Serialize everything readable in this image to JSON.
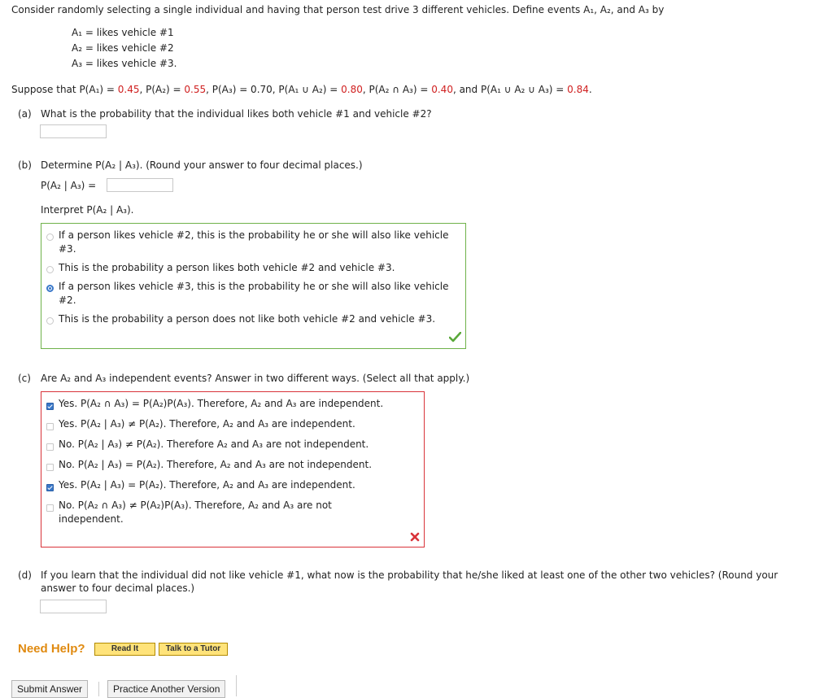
{
  "intro": "Consider randomly selecting a single individual and having that person test drive 3 different vehicles. Define events A₁, A₂, and A₃ by",
  "events": [
    "A₁ = likes vehicle #1",
    "A₂ = likes vehicle #2",
    "A₃ = likes vehicle #3."
  ],
  "suppose": {
    "prefix": "Suppose that ",
    "p1_label": "P(A₁) = ",
    "p1_value": "0.45",
    "p2_label": ", P(A₂) = ",
    "p2_value": "0.55",
    "p3_text": ", P(A₃) = 0.70, P(A₁ ∪ A₂) = ",
    "p12_value": "0.80",
    "p23_label": ", P(A₂ ∩ A₃) = ",
    "p23_value": "0.40",
    "p123_label": ", and P(A₁ ∪ A₂ ∪ A₃) = ",
    "p123_value": "0.84",
    "suffix": "."
  },
  "part_a": {
    "label": "(a)",
    "question": "What is the probability that the individual likes both vehicle #1 and vehicle #2?",
    "answer": ""
  },
  "part_b": {
    "label": "(b)",
    "question": "Determine P(A₂ | A₃). (Round your answer to four decimal places.)",
    "input_label": "P(A₂ | A₃) =",
    "answer": "",
    "interpret": "Interpret P(A₂ | A₃).",
    "options": [
      {
        "line1": "If a person likes vehicle #2, this is the probability he or she will also like vehicle",
        "line2": "#3."
      },
      {
        "line1": "This is the probability a person likes both vehicle #2 and vehicle #3.",
        "line2": ""
      },
      {
        "line1": "If a person likes vehicle #3, this is the probability he or she will also like vehicle",
        "line2": "#2."
      },
      {
        "line1": "This is the probability a person does not like both vehicle #2 and vehicle #3.",
        "line2": ""
      }
    ],
    "selected_index": 2,
    "result_icon": "check-icon",
    "result_color": "#5aa83a"
  },
  "part_c": {
    "label": "(c)",
    "question": "Are A₂ and A₃ independent events? Answer in two different ways. (Select all that apply.)",
    "options": [
      {
        "line1": "Yes. P(A₂ ∩ A₃) = P(A₂)P(A₃). Therefore, A₂ and A₃ are independent.",
        "line2": "",
        "checked": true
      },
      {
        "line1": "Yes. P(A₂ | A₃) ≠ P(A₂). Therefore, A₂ and A₃ are independent.",
        "line2": "",
        "checked": false
      },
      {
        "line1": "No. P(A₂ | A₃) ≠ P(A₂). Therefore A₂ and A₃ are not independent.",
        "line2": "",
        "checked": false
      },
      {
        "line1": "No. P(A₂ | A₃) = P(A₂). Therefore, A₂ and A₃ are not independent.",
        "line2": "",
        "checked": false
      },
      {
        "line1": "Yes. P(A₂ | A₃) = P(A₂). Therefore, A₂ and A₃ are independent.",
        "line2": "",
        "checked": true
      },
      {
        "line1": "No. P(A₂ ∩ A₃) ≠ P(A₂)P(A₃). Therefore, A₂ and A₃ are not",
        "line2": "independent.",
        "checked": false
      }
    ],
    "result_icon": "x-icon",
    "result_color": "#d9333a"
  },
  "part_d": {
    "label": "(d)",
    "line1": "If you learn that the individual did not like vehicle #1, what now is the probability that he/she liked at least one of the other two vehicles? (Round your",
    "line2": "answer to four decimal places.)",
    "answer": ""
  },
  "help": {
    "label": "Need Help?",
    "read_it": "Read It",
    "talk_tutor": "Talk to a Tutor"
  },
  "footer": {
    "submit": "Submit Answer",
    "practice": "Practice Another Version"
  },
  "colors": {
    "value_red": "#d02020",
    "correct_border": "#6fb24a",
    "wrong_border": "#d9333a",
    "help_orange": "#e08a10",
    "button_yellow": "#ffe37a"
  }
}
